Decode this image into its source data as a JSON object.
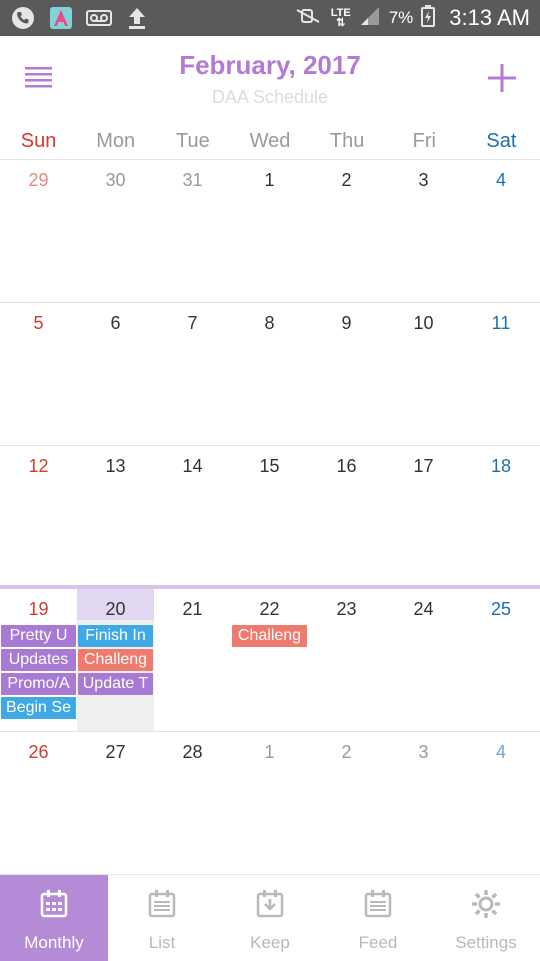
{
  "status_bar": {
    "battery": "7%",
    "network": "LTE",
    "time": "3:13 AM"
  },
  "header": {
    "title": "February, 2017",
    "subtitle": "DAA Schedule"
  },
  "weekdays": [
    "Sun",
    "Mon",
    "Tue",
    "Wed",
    "Thu",
    "Fri",
    "Sat"
  ],
  "weeks": [
    {
      "days": [
        {
          "num": "29",
          "other": true
        },
        {
          "num": "30",
          "other": true
        },
        {
          "num": "31",
          "other": true
        },
        {
          "num": "1"
        },
        {
          "num": "2"
        },
        {
          "num": "3"
        },
        {
          "num": "4"
        }
      ]
    },
    {
      "days": [
        {
          "num": "5"
        },
        {
          "num": "6"
        },
        {
          "num": "7"
        },
        {
          "num": "8"
        },
        {
          "num": "9"
        },
        {
          "num": "10"
        },
        {
          "num": "11"
        }
      ]
    },
    {
      "days": [
        {
          "num": "12"
        },
        {
          "num": "13"
        },
        {
          "num": "14"
        },
        {
          "num": "15"
        },
        {
          "num": "16"
        },
        {
          "num": "17"
        },
        {
          "num": "18"
        }
      ]
    },
    {
      "current": true,
      "days": [
        {
          "num": "19",
          "events": [
            {
              "label": "Pretty U",
              "color": "purple"
            },
            {
              "label": "Updates",
              "color": "purple"
            },
            {
              "label": "Promo/A",
              "color": "purple"
            },
            {
              "label": "Begin Se",
              "color": "blue"
            }
          ]
        },
        {
          "num": "20",
          "today": true,
          "events": [
            {
              "label": "Finish In",
              "color": "blue"
            },
            {
              "label": "Challeng",
              "color": "red"
            },
            {
              "label": "Update T",
              "color": "purple"
            }
          ]
        },
        {
          "num": "21"
        },
        {
          "num": "22",
          "events": [
            {
              "label": "Challeng",
              "color": "red"
            }
          ]
        },
        {
          "num": "23"
        },
        {
          "num": "24"
        },
        {
          "num": "25"
        }
      ]
    },
    {
      "days": [
        {
          "num": "26"
        },
        {
          "num": "27"
        },
        {
          "num": "28"
        },
        {
          "num": "1",
          "other": true
        },
        {
          "num": "2",
          "other": true
        },
        {
          "num": "3",
          "other": true
        },
        {
          "num": "4",
          "other": true
        }
      ]
    }
  ],
  "nav": [
    {
      "label": "Monthly",
      "icon": "calendar-grid-icon",
      "active": true
    },
    {
      "label": "List",
      "icon": "list-icon"
    },
    {
      "label": "Keep",
      "icon": "download-box-icon"
    },
    {
      "label": "Feed",
      "icon": "feed-icon"
    },
    {
      "label": "Settings",
      "icon": "gear-icon"
    }
  ],
  "colors": {
    "accent": "#b37bd6",
    "sunday": "#d8392b",
    "saturday": "#1d6fae",
    "event_purple": "#a87ad4",
    "event_blue": "#3fa9e5",
    "event_red": "#ef7a6e"
  }
}
